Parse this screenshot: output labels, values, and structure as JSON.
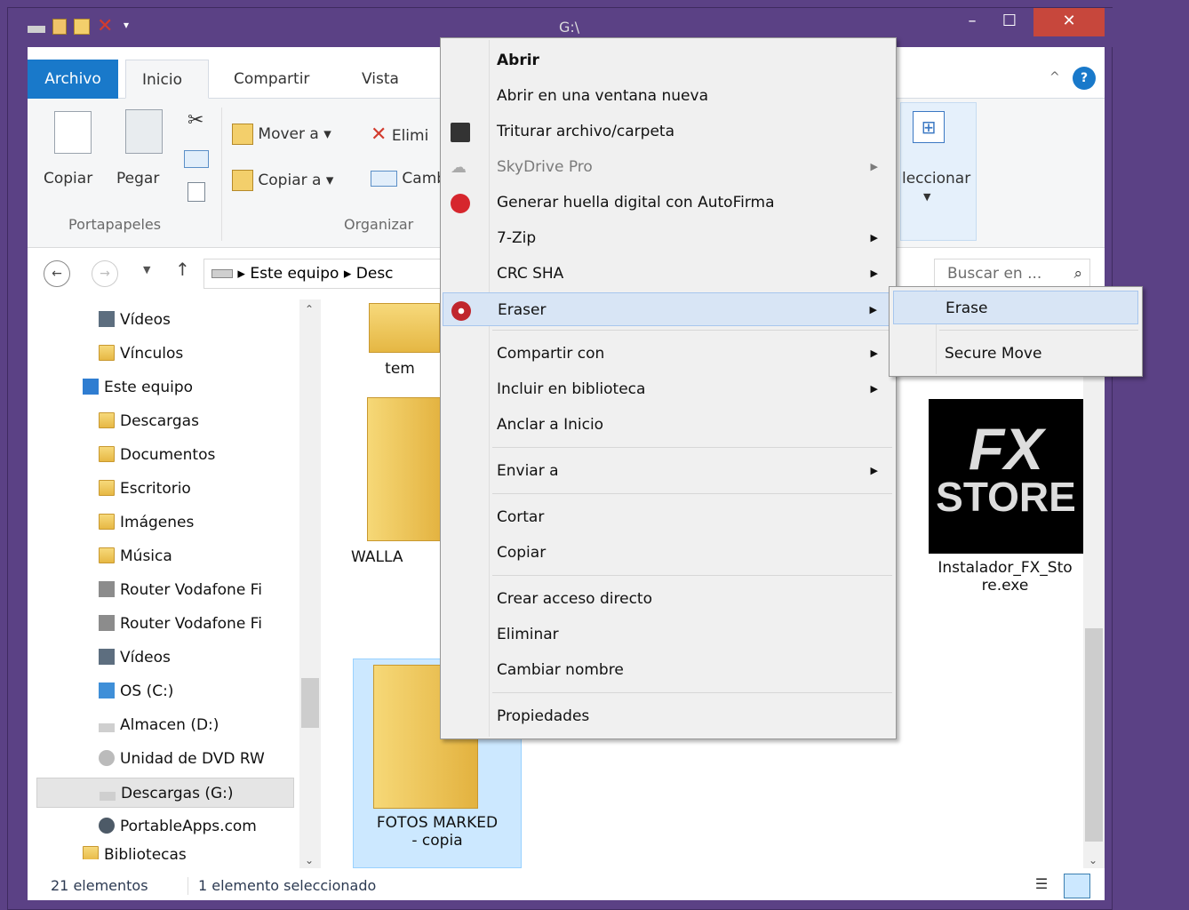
{
  "window": {
    "title": "G:\\"
  },
  "ribbon": {
    "tabs": [
      "Archivo",
      "Inicio",
      "Compartir",
      "Vista"
    ],
    "clipboard": {
      "copy": "Copiar",
      "paste": "Pegar",
      "group": "Portapapeles"
    },
    "organize": {
      "move_to": "Mover a",
      "copy_to": "Copiar a",
      "delete": "Elimi",
      "rename": "Camb",
      "group": "Organizar"
    },
    "select": {
      "label": "leccionar"
    }
  },
  "address": {
    "pc": "Este equipo",
    "next": "Desc",
    "search_placeholder": "Buscar en ..."
  },
  "nav": {
    "items": [
      "Vídeos",
      "Vínculos",
      "Este equipo",
      "Descargas",
      "Documentos",
      "Escritorio",
      "Imágenes",
      "Música",
      "Router Vodafone Fi",
      "Router Vodafone Fi",
      "Vídeos",
      "OS (C:)",
      "Almacen (D:)",
      "Unidad de DVD RW",
      "Descargas (G:)",
      "PortableApps.com",
      "Bibliotecas"
    ]
  },
  "files": {
    "f1": "tem",
    "f2": "WALLA",
    "f3_line1": "FOTOS MARKED",
    "f3_line2": "- copia",
    "f4_line1": "Instalador_FX_Sto",
    "f4_line2": "re.exe",
    "logo_fx": "FX",
    "logo_store": "STORE"
  },
  "status": {
    "count": "21 elementos",
    "selected": "1 elemento seleccionado"
  },
  "context_menu": {
    "items": [
      "Abrir",
      "Abrir en una ventana nueva",
      "Triturar archivo/carpeta",
      "SkyDrive Pro",
      "Generar huella digital con AutoFirma",
      "7-Zip",
      "CRC SHA",
      "Eraser",
      "Compartir con",
      "Incluir en biblioteca",
      "Anclar a Inicio",
      "Enviar a",
      "Cortar",
      "Copiar",
      "Crear acceso directo",
      "Eliminar",
      "Cambiar nombre",
      "Propiedades"
    ]
  },
  "submenu": {
    "items": [
      "Erase",
      "Secure Move"
    ]
  },
  "colors": {
    "accent": "#1979ca",
    "titlebar": "#5b4185",
    "close": "#c7473c",
    "hover": "#d8e5f5"
  }
}
